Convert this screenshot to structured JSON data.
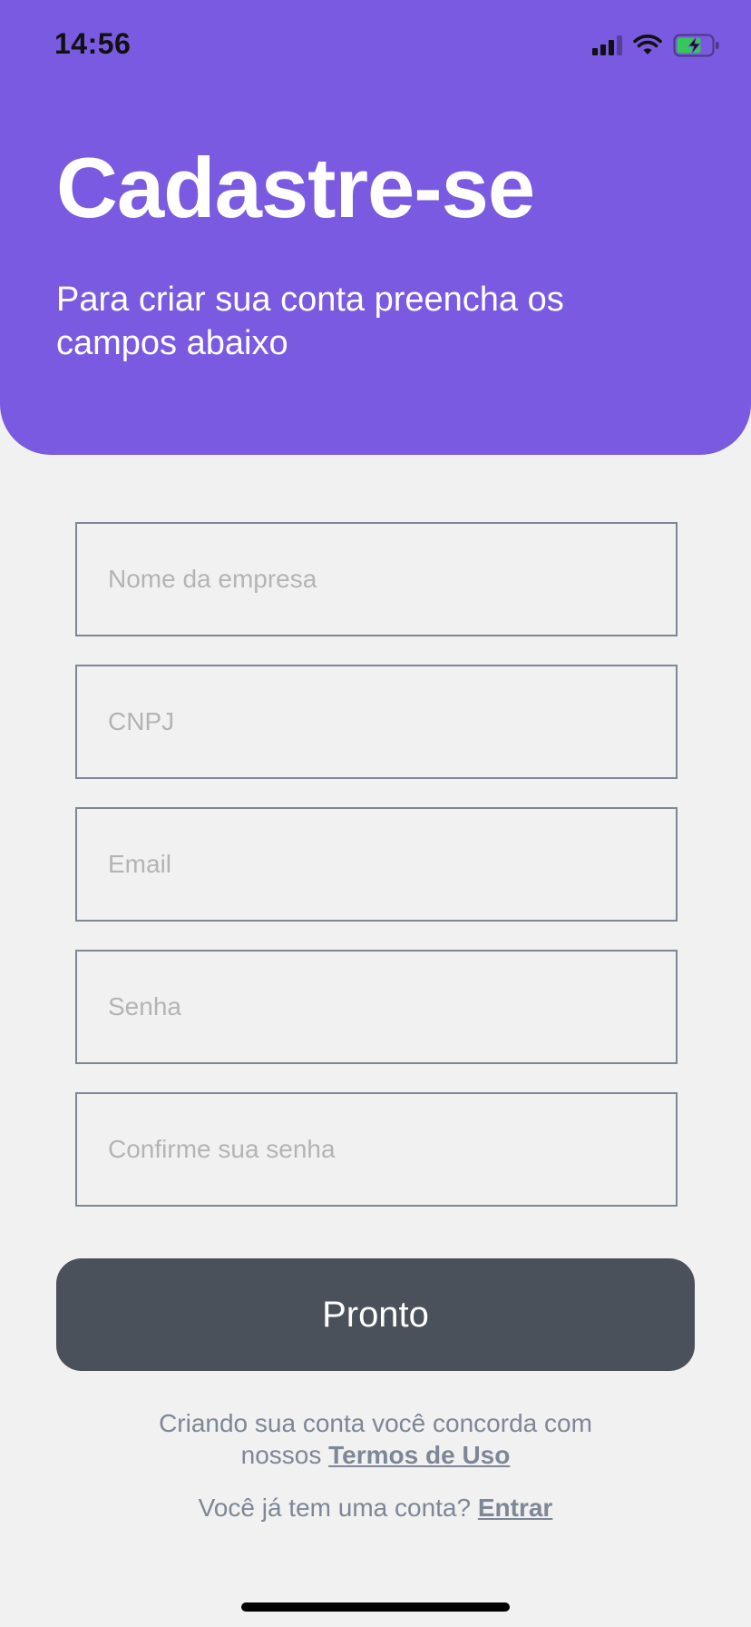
{
  "status_bar": {
    "time": "14:56",
    "icons": [
      "cellular-signal-icon",
      "wifi-icon",
      "battery-charging-icon"
    ],
    "battery_color": "#34c759"
  },
  "header": {
    "title": "Cadastre-se",
    "subtitle": "Para criar sua conta preencha os campos abaixo",
    "background_color": "#7a5ae0"
  },
  "form": {
    "fields": [
      {
        "placeholder": "Nome da empresa",
        "value": ""
      },
      {
        "placeholder": "CNPJ",
        "value": ""
      },
      {
        "placeholder": "Email",
        "value": ""
      },
      {
        "placeholder": "Senha",
        "value": ""
      },
      {
        "placeholder": "Confirme sua senha",
        "value": ""
      }
    ],
    "submit_label": "Pronto",
    "submit_color": "#4a515a"
  },
  "footer": {
    "terms_prefix": "Criando sua conta você concorda com nossos ",
    "terms_link": "Termos de Uso",
    "login_prefix": "Você já tem uma conta? ",
    "login_link": "Entrar"
  }
}
